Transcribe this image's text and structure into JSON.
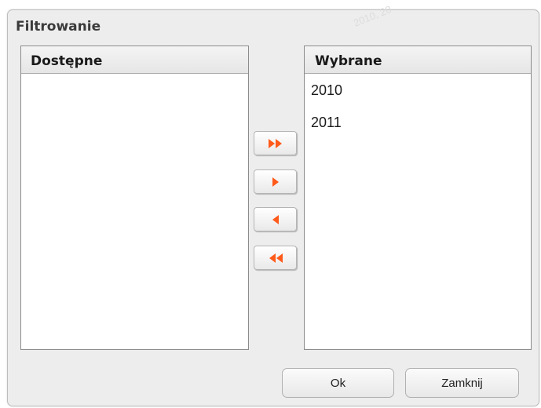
{
  "dialog": {
    "title": "Filtrowanie",
    "watermark": "2010, 20"
  },
  "available": {
    "header": "Dostępne",
    "items": []
  },
  "selected": {
    "header": "Wybrane",
    "items": [
      "2010",
      "2011"
    ]
  },
  "move_buttons": {
    "add_all_icon": "double-arrow-right-icon",
    "add_icon": "arrow-right-icon",
    "remove_icon": "arrow-left-icon",
    "remove_all_icon": "double-arrow-left-icon",
    "icon_color": "#ff5a1a"
  },
  "footer": {
    "ok_label": "Ok",
    "close_label": "Zamknij"
  }
}
